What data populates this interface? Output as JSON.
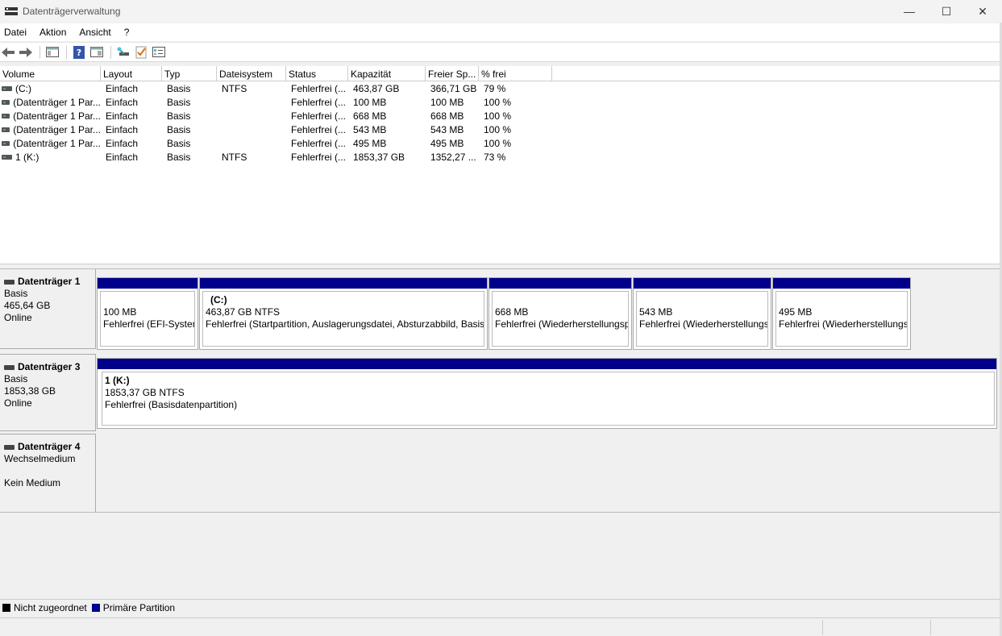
{
  "window": {
    "title": "Datenträgerverwaltung",
    "controls": {
      "minimize": "—",
      "maximize": "☐",
      "close": "✕"
    }
  },
  "menu": [
    "Datei",
    "Aktion",
    "Ansicht",
    "?"
  ],
  "toolbar": [
    "back-icon",
    "forward-icon",
    "console-tree-icon",
    "help-icon",
    "show-hide-icon",
    "connect-icon",
    "check-icon",
    "properties-icon"
  ],
  "volumes": {
    "columns": [
      "Volume",
      "Layout",
      "Typ",
      "Dateisystem",
      "Status",
      "Kapazität",
      "Freier Sp...",
      "% frei"
    ],
    "rows": [
      [
        "(C:)",
        "Einfach",
        "Basis",
        "NTFS",
        "Fehlerfrei (...",
        "463,87 GB",
        "366,71 GB",
        "79 %"
      ],
      [
        "(Datenträger 1 Par...",
        "Einfach",
        "Basis",
        "",
        "Fehlerfrei (...",
        "100 MB",
        "100 MB",
        "100 %"
      ],
      [
        "(Datenträger 1 Par...",
        "Einfach",
        "Basis",
        "",
        "Fehlerfrei (...",
        "668 MB",
        "668 MB",
        "100 %"
      ],
      [
        "(Datenträger 1 Par...",
        "Einfach",
        "Basis",
        "",
        "Fehlerfrei (...",
        "543 MB",
        "543 MB",
        "100 %"
      ],
      [
        "(Datenträger 1 Par...",
        "Einfach",
        "Basis",
        "",
        "Fehlerfrei (...",
        "495 MB",
        "495 MB",
        "100 %"
      ],
      [
        "1 (K:)",
        "Einfach",
        "Basis",
        "NTFS",
        "Fehlerfrei (...",
        "1853,37 GB",
        "1352,27 ...",
        "73 %"
      ]
    ]
  },
  "disks": [
    {
      "name": "Datenträger 1",
      "type": "Basis",
      "size": "465,64 GB",
      "state": "Online",
      "partitions": [
        {
          "name": "",
          "size": "100 MB",
          "status": "Fehlerfrei (EFI-Systempartition)"
        },
        {
          "name": "(C:)",
          "size": "463,87 GB NTFS",
          "status": "Fehlerfrei (Startpartition, Auslagerungsdatei, Absturzabbild, Basisdatenpartition)"
        },
        {
          "name": "",
          "size": "668 MB",
          "status": "Fehlerfrei (Wiederherstellungspartition)"
        },
        {
          "name": "",
          "size": "543 MB",
          "status": "Fehlerfrei (Wiederherstellungspartition)"
        },
        {
          "name": "",
          "size": "495 MB",
          "status": "Fehlerfrei (Wiederherstellungspartition)"
        }
      ]
    },
    {
      "name": "Datenträger 3",
      "type": "Basis",
      "size": "1853,38 GB",
      "state": "Online",
      "partitions": [
        {
          "name": "1  (K:)",
          "size": "1853,37 GB NTFS",
          "status": "Fehlerfrei (Basisdatenpartition)"
        }
      ]
    },
    {
      "name": "Datenträger 4",
      "type": "Wechselmedium",
      "size": "",
      "state": "Kein Medium",
      "partitions": []
    }
  ],
  "legend": [
    {
      "label": "Nicht zugeordnet",
      "color": "#000000"
    },
    {
      "label": "Primäre Partition",
      "color": "#00008b"
    }
  ]
}
